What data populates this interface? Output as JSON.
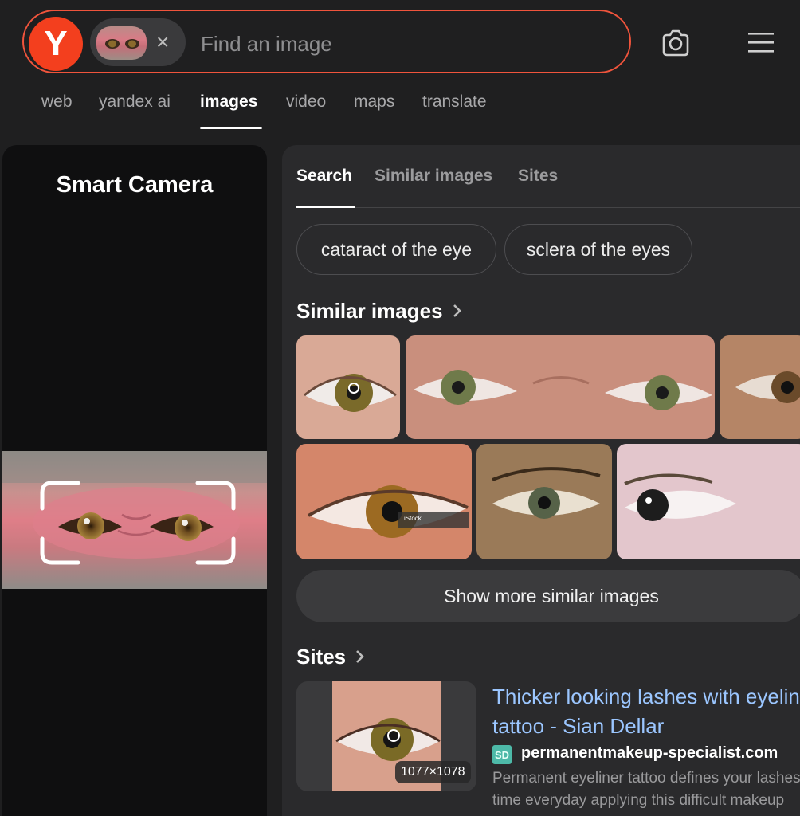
{
  "header": {
    "logo_letter": "Y",
    "search_placeholder": "Find an image",
    "chip_close": "×"
  },
  "services": [
    {
      "label": "web",
      "active": false
    },
    {
      "label": "yandex ai",
      "active": false
    },
    {
      "label": "images",
      "active": true
    },
    {
      "label": "video",
      "active": false
    },
    {
      "label": "maps",
      "active": false
    },
    {
      "label": "translate",
      "active": false
    }
  ],
  "left_panel": {
    "title": "Smart Camera"
  },
  "results": {
    "tabs": [
      {
        "label": "Search",
        "active": true
      },
      {
        "label": "Similar images",
        "active": false
      },
      {
        "label": "Sites",
        "active": false
      }
    ],
    "suggestions": [
      "cataract of the eye",
      "sclera of the eyes"
    ],
    "similar_title": "Similar images",
    "show_more": "Show more similar images",
    "sites_title": "Sites",
    "site": {
      "title_line1": "Thicker looking lashes with eyeliner",
      "title_line2": "tattoo - Sian Dellar",
      "favicon": "SD",
      "domain": "permanentmakeup-specialist.com",
      "snippet_line1": "Permanent eyeliner tattoo defines your lashes",
      "snippet_line2": "time everyday applying this difficult makeup",
      "image_dims": "1077×1078"
    },
    "watermark": "iStock"
  },
  "colors": {
    "accent": "#f0543c",
    "logo": "#f33f1e",
    "link": "#9bc6ff"
  }
}
